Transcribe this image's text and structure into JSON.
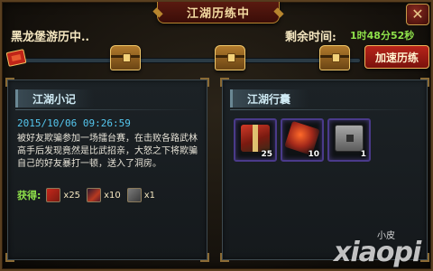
{
  "window": {
    "title": "江湖历练中",
    "close_icon": "close-icon"
  },
  "status": {
    "location": "黑龙堡游历中..",
    "remaining_label": "剩余时间:",
    "remaining_value": "1时48分52秒"
  },
  "progress": {
    "fraction": 0.0,
    "flag_icon": "red-flag-icon",
    "chest_icon": "treasure-chest-icon",
    "chest_count": 3
  },
  "actions": {
    "speed_up_label": "加速历练"
  },
  "journal": {
    "header": "江湖小记",
    "date": "2015/10/06 09:26:59",
    "text": "被好友欺骗参加一场擂台赛，在击败各路武林高手后发现竟然是比武招亲，大怒之下将欺骗自己的好友暴打一顿，送入了洞房。",
    "rewards_label": "获得:",
    "rewards": [
      {
        "icon": "gift-box-icon",
        "count": "x25"
      },
      {
        "icon": "red-gem-icon",
        "count": "x10"
      },
      {
        "icon": "metal-case-icon",
        "count": "x1"
      }
    ]
  },
  "bag": {
    "header": "江湖行囊",
    "items": [
      {
        "icon": "gift-box-icon",
        "count": "25"
      },
      {
        "icon": "red-gem-icon",
        "count": "10"
      },
      {
        "icon": "metal-case-icon",
        "count": "1"
      }
    ]
  },
  "watermark": {
    "small": "小皮",
    "big": "xiaopi"
  },
  "colors": {
    "time_green": "#8ee04a",
    "date_blue": "#55c8f0",
    "button_red": "#b8241a",
    "slot_border": "#4a3a8a"
  }
}
